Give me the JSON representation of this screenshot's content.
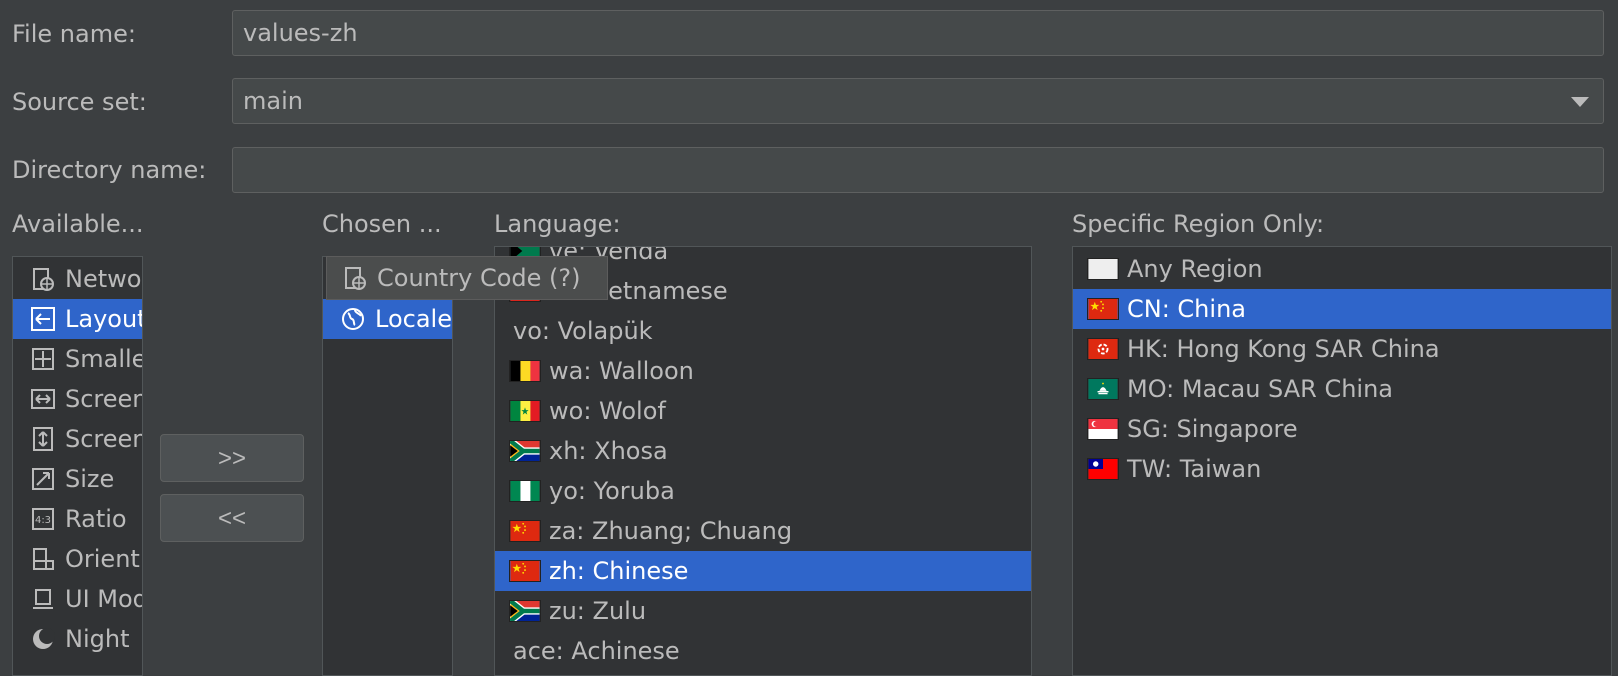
{
  "form": {
    "file_name_label": "File name:",
    "file_name_value": "values-zh",
    "source_set_label": "Source set:",
    "source_set_value": "main",
    "directory_name_label": "Directory name:",
    "directory_name_value": ""
  },
  "available": {
    "header": "Available...",
    "items": [
      {
        "label": "Netwo",
        "icon": "network-code-icon"
      },
      {
        "label": "Layout",
        "icon": "layout-direction-icon"
      },
      {
        "label": "Smalle",
        "icon": "smallest-screen-width-icon"
      },
      {
        "label": "Screen",
        "icon": "screen-width-icon"
      },
      {
        "label": "Screen",
        "icon": "screen-height-icon"
      },
      {
        "label": "Size",
        "icon": "size-icon"
      },
      {
        "label": "Ratio",
        "icon": "ratio-icon"
      },
      {
        "label": "Orient",
        "icon": "orientation-icon"
      },
      {
        "label": "UI Mod",
        "icon": "ui-mode-icon"
      },
      {
        "label": "Night",
        "icon": "night-mode-icon"
      }
    ]
  },
  "buttons": {
    "add": ">>",
    "remove": "<<"
  },
  "chosen": {
    "header": "Chosen ...",
    "items": [
      {
        "label": "Locale",
        "icon": "globe-icon"
      }
    ],
    "tooltip": "Country Code (?)"
  },
  "language": {
    "header": "Language:",
    "items": [
      {
        "label": "ve: Venda",
        "flag": "venda"
      },
      {
        "label": "vi: Vietnamese",
        "flag": "vietnam"
      },
      {
        "label": "vo: Volapük",
        "flag": ""
      },
      {
        "label": "wa: Walloon",
        "flag": "belgium"
      },
      {
        "label": "wo: Wolof",
        "flag": "senegal"
      },
      {
        "label": "xh: Xhosa",
        "flag": "south-africa"
      },
      {
        "label": "yo: Yoruba",
        "flag": "nigeria"
      },
      {
        "label": "za: Zhuang; Chuang",
        "flag": "china"
      },
      {
        "label": "zh: Chinese",
        "flag": "china"
      },
      {
        "label": "zu: Zulu",
        "flag": "south-africa"
      },
      {
        "label": "ace: Achinese",
        "flag": ""
      }
    ]
  },
  "region": {
    "header": "Specific Region Only:",
    "items": [
      {
        "label": "Any Region",
        "flag": "blank"
      },
      {
        "label": "CN: China",
        "flag": "china"
      },
      {
        "label": "HK: Hong Kong SAR China",
        "flag": "hong-kong"
      },
      {
        "label": "MO: Macau SAR China",
        "flag": "macau"
      },
      {
        "label": "SG: Singapore",
        "flag": "singapore"
      },
      {
        "label": "TW: Taiwan",
        "flag": "taiwan"
      }
    ]
  },
  "colors": {
    "background": "#3c3f41",
    "selection": "#2f65ca",
    "text": "#bbbbbb"
  }
}
